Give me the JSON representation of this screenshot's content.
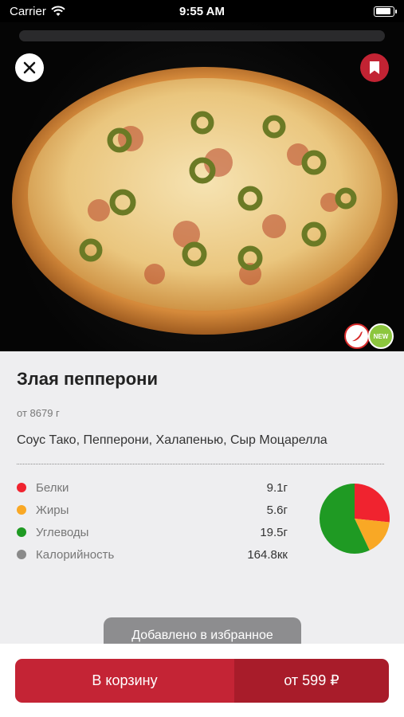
{
  "status_bar": {
    "carrier": "Carrier",
    "time": "9:55 AM"
  },
  "product": {
    "title": "Злая пепперони",
    "weight": "от 8679 г",
    "ingredients": "Соус Тако, Пепперони, Халапенью, Сыр Моцарелла"
  },
  "badges": {
    "new_label": "NEW"
  },
  "nutrition": [
    {
      "label": "Белки",
      "value": "9.1г",
      "color": "#f0232f"
    },
    {
      "label": "Жиры",
      "value": "5.6г",
      "color": "#f9a825"
    },
    {
      "label": "Углеводы",
      "value": "19.5г",
      "color": "#1f9a23"
    },
    {
      "label": "Калорийность",
      "value": "164.8кк",
      "color": "#8a8a8a"
    }
  ],
  "chart_data": {
    "type": "pie",
    "categories": [
      "Белки",
      "Жиры",
      "Углеводы"
    ],
    "values": [
      9.1,
      5.6,
      19.5
    ],
    "colors": [
      "#f0232f",
      "#f9a825",
      "#1f9a23"
    ]
  },
  "toast": {
    "text": "Добавлено в избранное"
  },
  "cart": {
    "label": "В корзину",
    "price": "от 599 ₽"
  },
  "icons": {
    "close": "close-icon",
    "bookmark": "bookmark-icon",
    "hot": "chili-icon"
  },
  "colors": {
    "accent": "#c42435",
    "accent_dark": "#a81c2a"
  }
}
